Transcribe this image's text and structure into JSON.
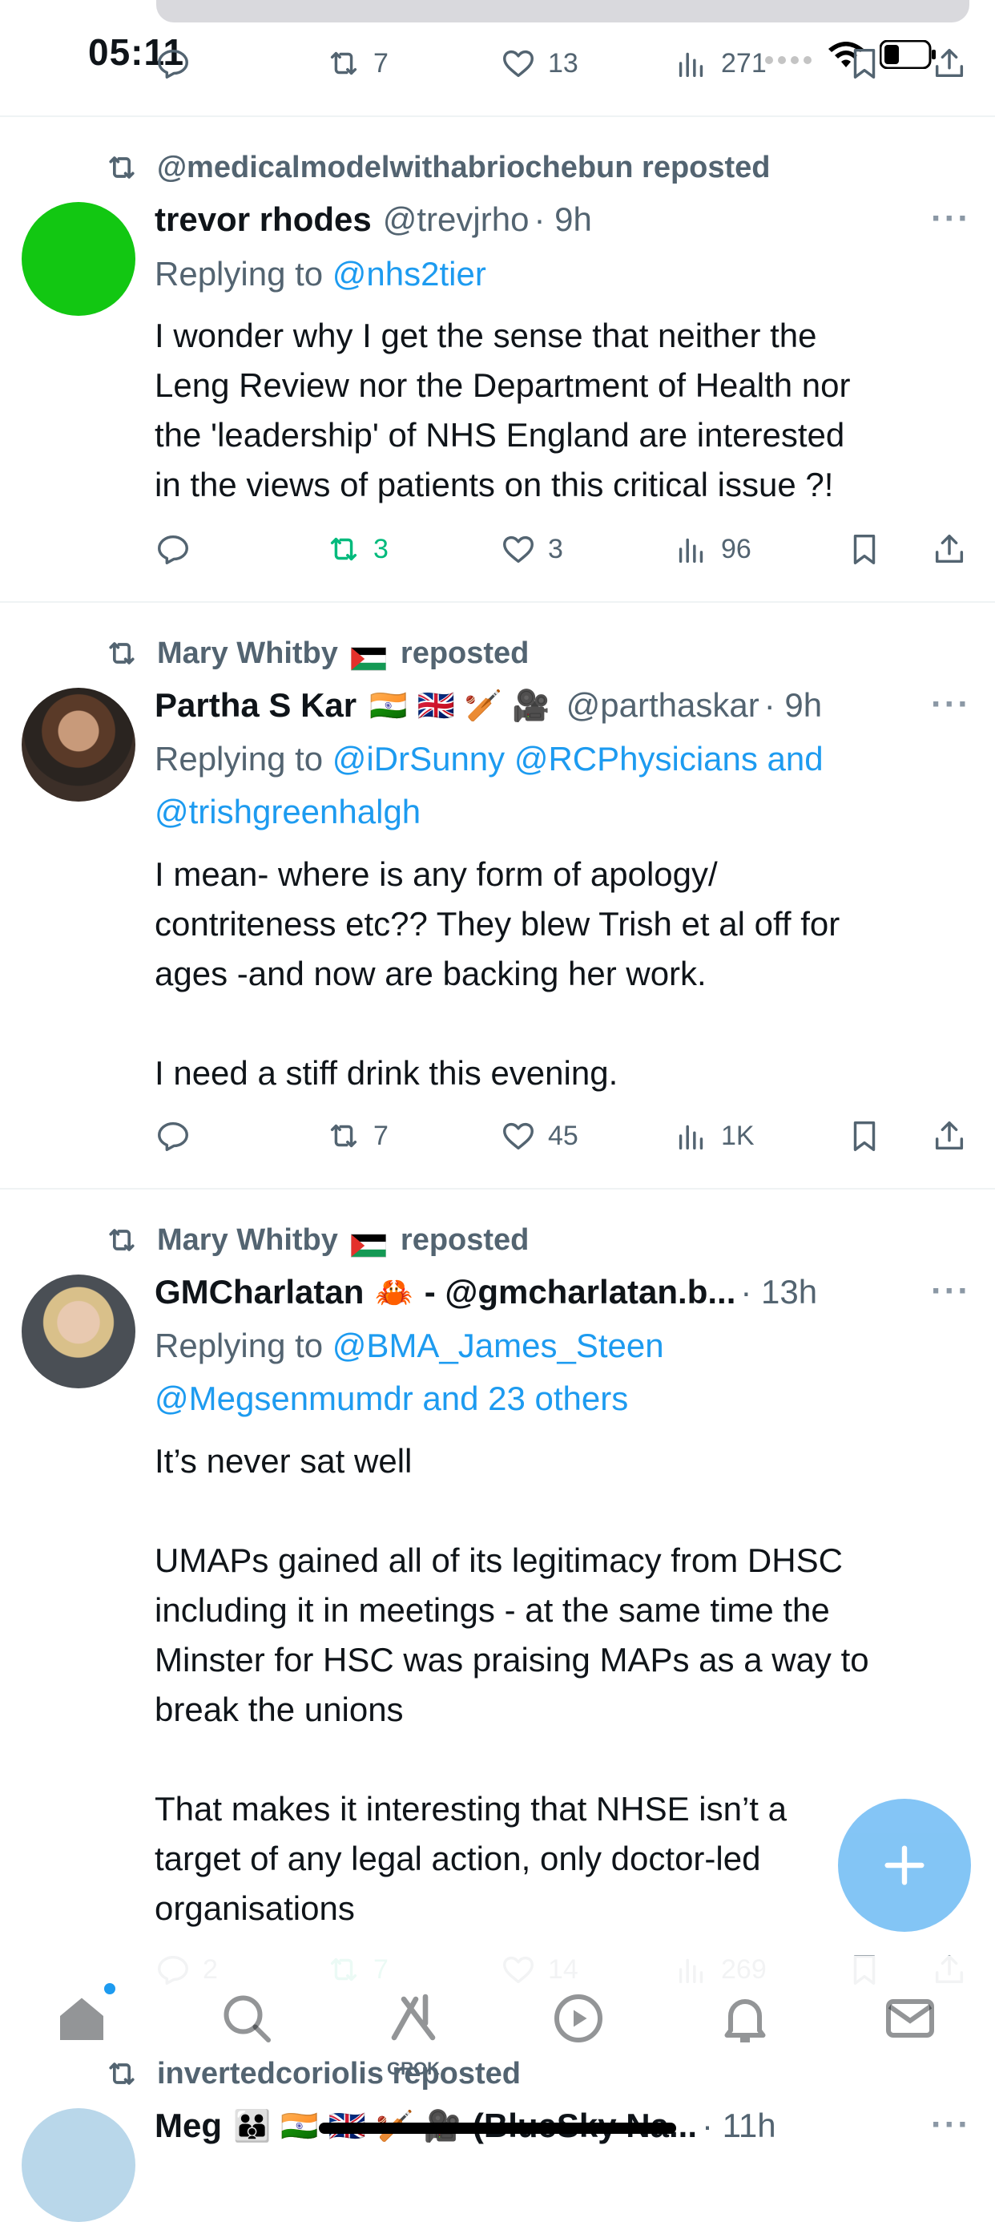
{
  "status_bar": {
    "time": "05:11"
  },
  "tweets": [
    {
      "stats": {
        "reply": "",
        "retweet": "7",
        "like": "13",
        "views": "271"
      }
    },
    {
      "reposted_by": "@medicalmodelwithabriochebun reposted",
      "name": "trevor rhodes",
      "handle": "@trevjrho",
      "time": "· 9h",
      "reply_prefix": "Replying to ",
      "reply_targets": "@nhs2tier",
      "text": "I wonder why I get the sense that neither the\nLeng Review nor the Department of Health nor\nthe 'leadership' of NHS England are interested\nin the views of patients on this critical issue ?!",
      "stats": {
        "reply": "",
        "retweet": "3",
        "like": "3",
        "views": "96"
      }
    },
    {
      "reposted_by_name": "Mary Whitby",
      "reposted_suffix": "reposted",
      "name": "Partha S Kar",
      "name_emojis": "🇮🇳 🇬🇧 🏏 🎥",
      "handle": "@parthaskar",
      "time": "· 9h",
      "reply_prefix": "Replying to ",
      "reply_targets_line1": "@iDrSunny @RCPhysicians and",
      "reply_targets_line2": "@trishgreenhalgh",
      "text": "I mean- where is any form of apology/\ncontriteness etc?? They blew Trish et al off for\nages -and now are backing her work.\n\nI need a stiff drink this evening.",
      "stats": {
        "reply": "",
        "retweet": "7",
        "like": "45",
        "views": "1K"
      }
    },
    {
      "reposted_by_name": "Mary Whitby",
      "reposted_suffix": "reposted",
      "name": "GMCharlatan",
      "name_emoji": "🦀",
      "name_rest": "- @gmcharlatan.b...",
      "time": "· 13h",
      "reply_prefix": "Replying to ",
      "reply_targets_line1": "@BMA_James_Steen",
      "reply_targets_line2": "@Megsenmumdr and 23 others",
      "text": "It’s never sat well\n\nUMAPs gained all of its legitimacy from DHSC\nincluding it in meetings - at the same time the\nMinster for HSC was praising MAPs as a way to\nbreak the unions\n\nThat makes it interesting that NHSE isn’t a\ntarget of any legal action, only doctor-led\norganisations",
      "stats": {
        "reply": "2",
        "retweet": "7",
        "like": "14",
        "views": "269"
      }
    },
    {
      "reposted_by": "invertedcoriolis reposted",
      "name": "Meg",
      "name_rest": "(BlueSky Na...",
      "time": "· 11h"
    }
  ],
  "tabbar": {
    "grok_label": "GROK"
  },
  "colors": {
    "accent": "#1d9bf0",
    "retweet_active": "#00ba7c",
    "secondary_text": "#536471",
    "fab": "#7dc2f5"
  },
  "icons": [
    "reply-icon",
    "retweet-icon",
    "like-icon",
    "views-icon",
    "bookmark-icon",
    "share-icon",
    "home-icon",
    "search-icon",
    "grok-icon",
    "video-icon",
    "notifications-icon",
    "messages-icon",
    "compose-icon"
  ]
}
